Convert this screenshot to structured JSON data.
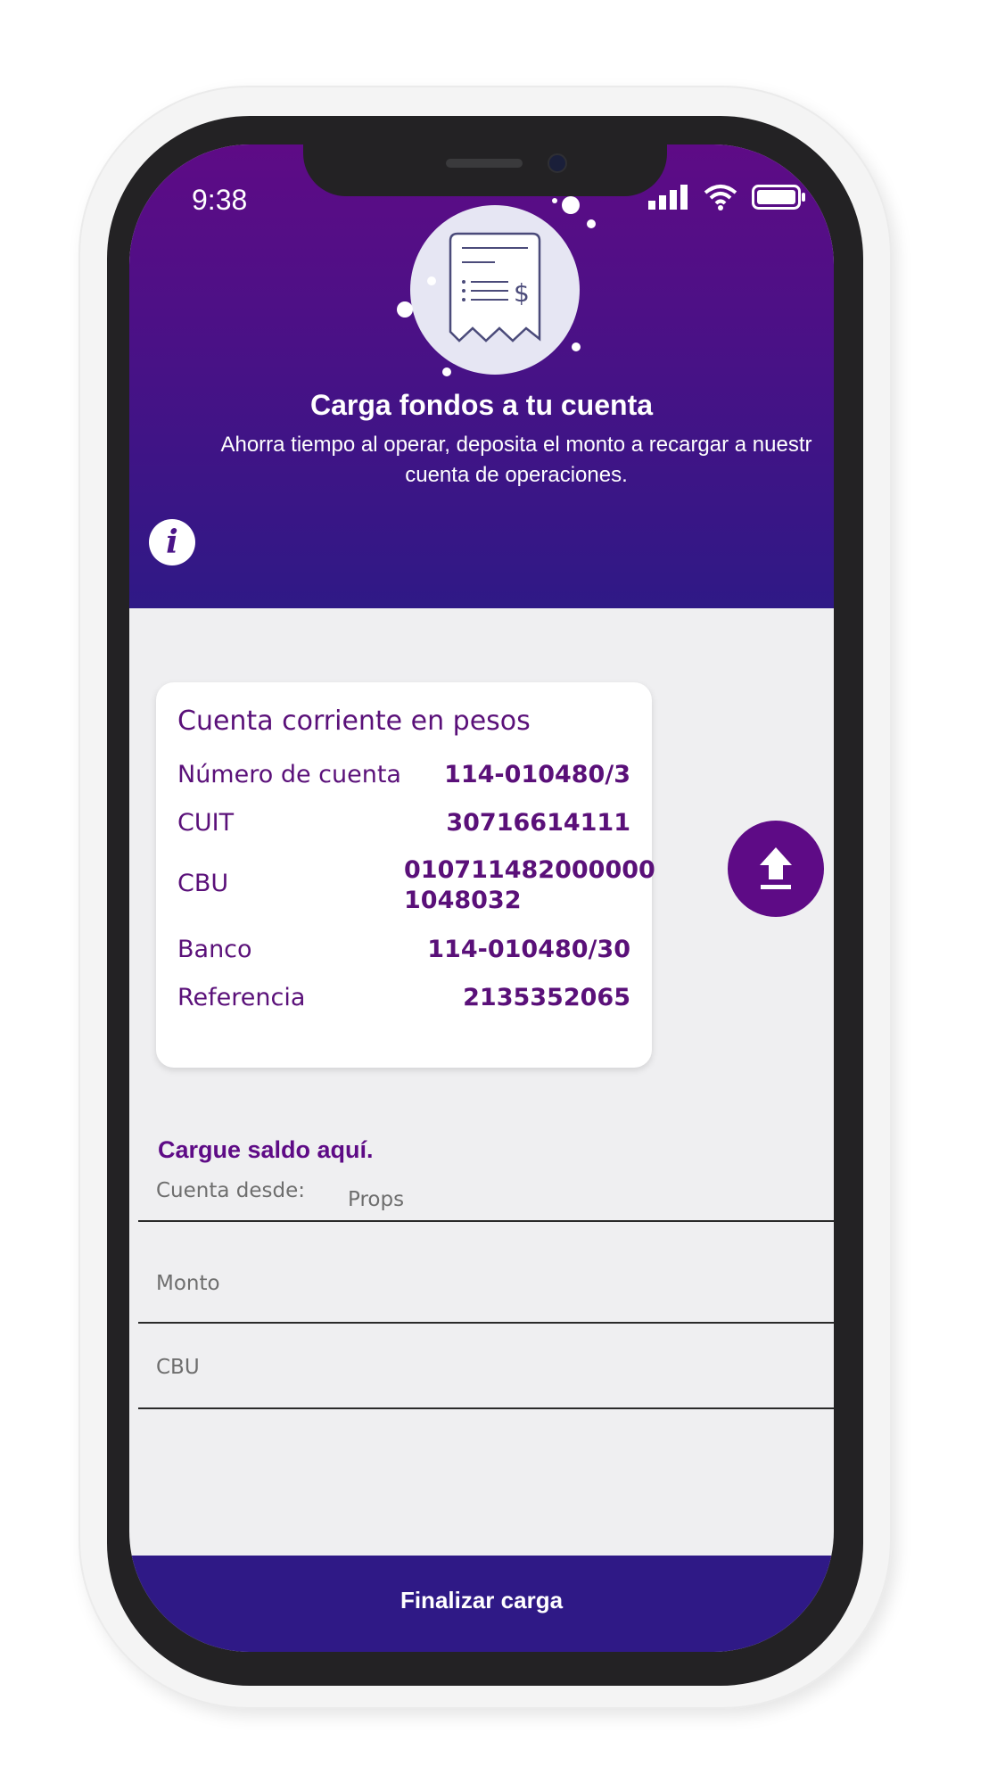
{
  "status_bar": {
    "time": "9:38",
    "icons": [
      "signal-icon",
      "wifi-icon",
      "battery-icon"
    ]
  },
  "header": {
    "illustration": "receipt-icon",
    "title": "Carga fondos a tu cuenta",
    "subtitle": "Ahorra tiempo al operar, deposita el monto a recargar a nuestr\ncuenta de operaciones.",
    "info_icon": "i"
  },
  "account_card": {
    "title": "Cuenta corriente en pesos",
    "rows": [
      {
        "label": "Número de cuenta",
        "value": "114-010480/3"
      },
      {
        "label": "CUIT",
        "value": "30716614111"
      },
      {
        "label": "CBU",
        "value": "0107114820000001048032"
      },
      {
        "label": "Banco",
        "value": "114-010480/30"
      },
      {
        "label": "Referencia",
        "value": "2135352065"
      }
    ],
    "cbu_line1": "010711482000000",
    "cbu_line2": "1048032"
  },
  "upload_button": {
    "icon": "upload-icon"
  },
  "form": {
    "title": "Cargue saldo aquí.",
    "from_account_label": "Cuenta desde:",
    "from_account_value": "Props",
    "amount_label": "Monto",
    "cbu_label": "CBU"
  },
  "footer": {
    "finish_label": "Finalizar carga"
  },
  "colors": {
    "primary": "#5e0b86",
    "secondary": "#2f1986",
    "background": "#efeff1"
  }
}
